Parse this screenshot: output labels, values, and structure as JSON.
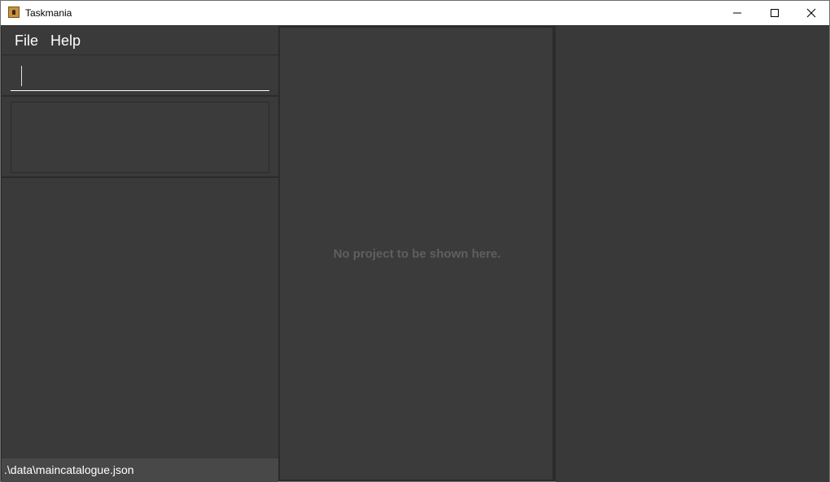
{
  "window": {
    "title": "Taskmania",
    "icon": "app-logo-icon",
    "controls": [
      "minimize-icon",
      "maximize-icon",
      "close-icon"
    ]
  },
  "menu": {
    "items": [
      {
        "label": "File"
      },
      {
        "label": "Help"
      }
    ]
  },
  "command": {
    "value": "",
    "placeholder": ""
  },
  "result": {
    "text": ""
  },
  "project_view": {
    "empty_message": "No project to be shown here."
  },
  "status": {
    "file_path": ".\\data\\maincatalogue.json"
  },
  "colors": {
    "background": "#2b2b2b",
    "panel": "#3a3a3a",
    "status_bar": "#484848",
    "muted_text": "#5f5f5f",
    "text": "#ffffff"
  }
}
